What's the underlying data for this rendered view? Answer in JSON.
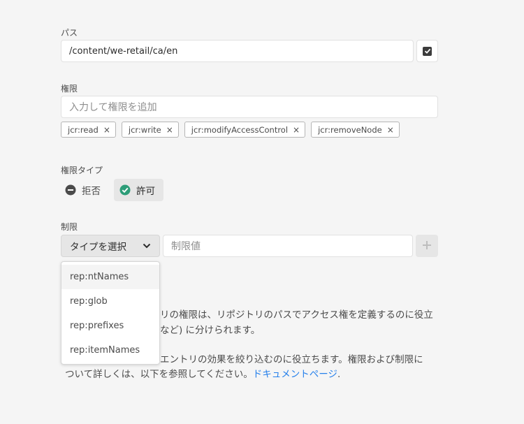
{
  "path": {
    "label": "パス",
    "value": "/content/we-retail/ca/en",
    "checkbox_checked": true
  },
  "privileges": {
    "label": "権限",
    "placeholder": "入力して権限を追加",
    "tags": [
      "jcr:read",
      "jcr:write",
      "jcr:modifyAccessControl",
      "jcr:removeNode"
    ],
    "remove_glyph": "×"
  },
  "permission_type": {
    "label": "権限タイプ",
    "options": [
      {
        "label": "拒否",
        "icon": "minus-circle-icon",
        "selected": false
      },
      {
        "label": "許可",
        "icon": "check-circle-icon",
        "selected": true
      }
    ]
  },
  "restrictions": {
    "label": "制限",
    "select_label": "タイプを選択",
    "value_placeholder": "制限値",
    "dropdown_options": [
      "rep:ntNames",
      "rep:glob",
      "rep:prefixes",
      "rep:itemNames"
    ]
  },
  "description": {
    "line1_tail": "リの権限は、リポジトリのパスでアクセス権を定義するのに役立",
    "line2_tail": "など) に分けられます。",
    "line3_tail": "エントリの効果を絞り込むのに役立ちます。権限および制限に",
    "line4": "ついて詳しくは、以下を参照してください。",
    "link_text": "ドキュメントページ",
    "line4_end": "."
  },
  "colors": {
    "accent_link": "#2680eb",
    "check_green": "#2d9d78",
    "dark_icon": "#4b4b4b"
  }
}
